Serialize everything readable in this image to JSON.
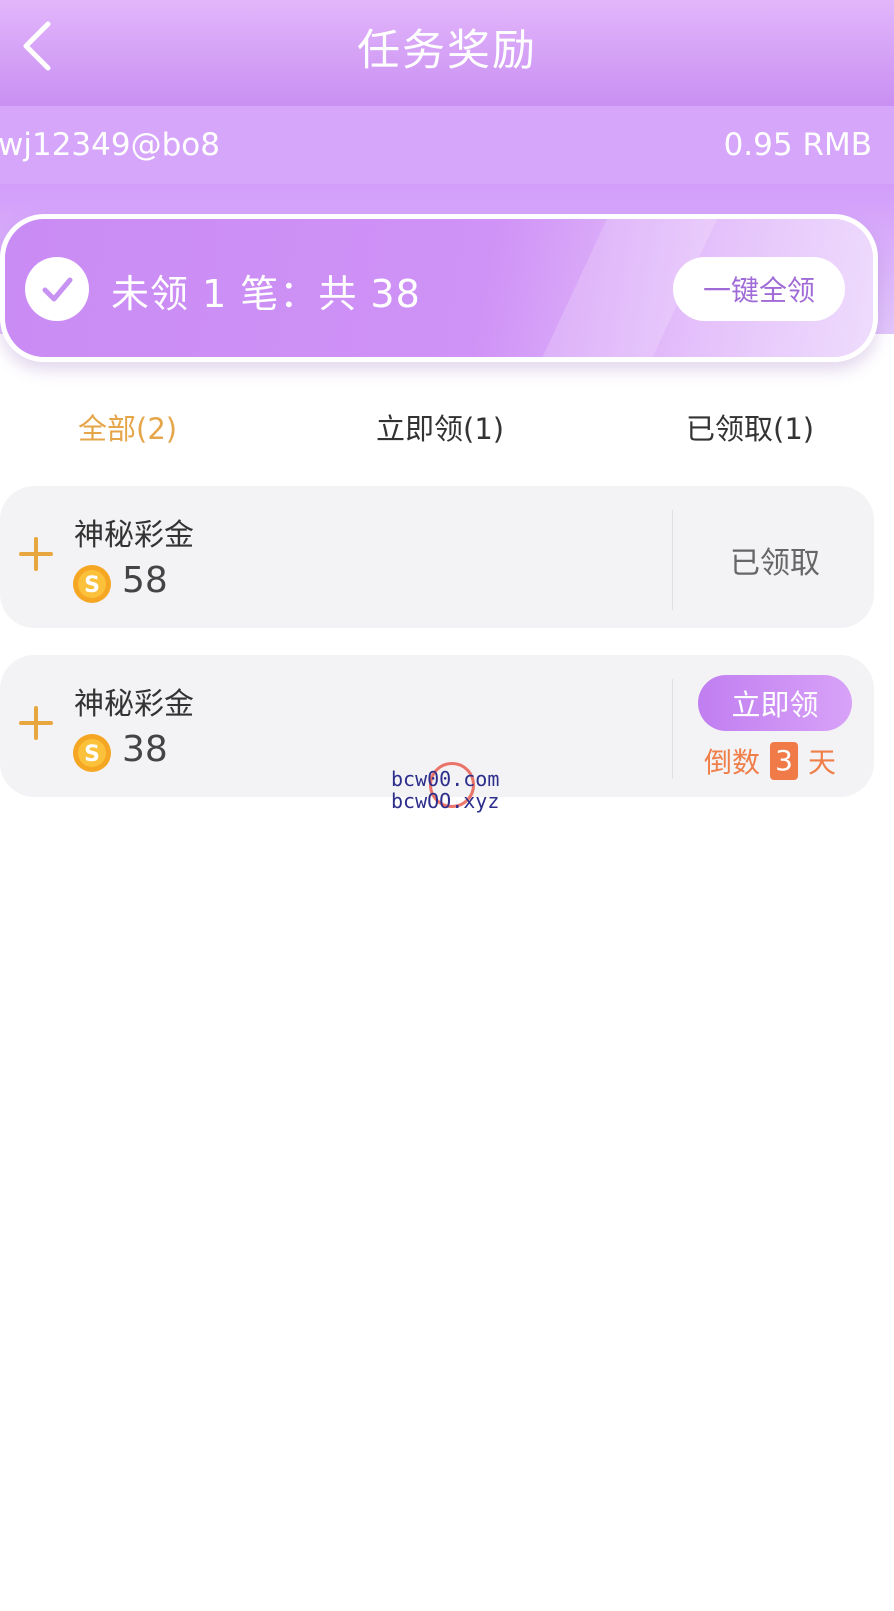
{
  "header": {
    "title": "任务奖励",
    "back_icon": "chevron-left-icon"
  },
  "account": {
    "username": "wj12349@bo8",
    "balance": "0.95 RMB"
  },
  "summary": {
    "text": "未领 1 笔：共 38",
    "claim_all_label": "一键全领",
    "check_icon": "check-circle-icon"
  },
  "tabs": [
    {
      "label": "全部(2)",
      "active": true
    },
    {
      "label": "立即领(1)",
      "active": false
    },
    {
      "label": "已领取(1)",
      "active": false
    }
  ],
  "rewards": [
    {
      "name": "神秘彩金",
      "amount": "58",
      "status_label": "已领取"
    },
    {
      "name": "神秘彩金",
      "amount": "38",
      "claim_label": "立即领",
      "countdown_prefix": "倒数",
      "countdown_days": "3",
      "countdown_suffix": "天"
    }
  ],
  "watermark": {
    "line1": "bcw00.com",
    "line2": "bcwOO.xyz"
  },
  "colors": {
    "header": "#c98ff2",
    "active_tab": "#e5a64a",
    "countdown": "#ef7e49",
    "card_bg": "#f3f3f5"
  }
}
